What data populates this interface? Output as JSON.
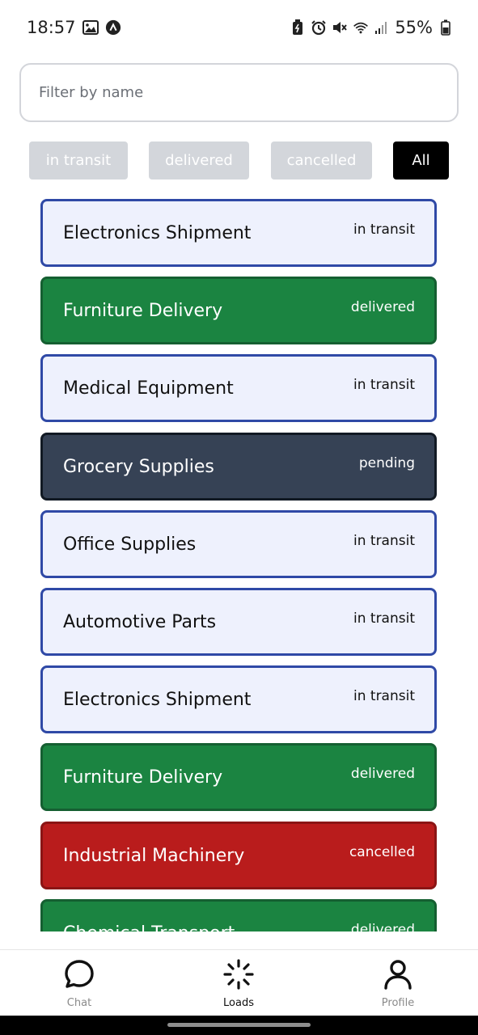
{
  "status_bar": {
    "time": "18:57",
    "battery_percent": "55%",
    "icons_left": [
      "image-icon",
      "app-notification-icon"
    ],
    "icons_right": [
      "battery-saver-icon",
      "alarm-icon",
      "mute-icon",
      "wifi-icon",
      "signal-icon",
      "battery-icon"
    ]
  },
  "search": {
    "placeholder": "Filter by name",
    "value": ""
  },
  "filters": [
    {
      "label": "in transit",
      "active": false
    },
    {
      "label": "delivered",
      "active": false
    },
    {
      "label": "cancelled",
      "active": false
    },
    {
      "label": "All",
      "active": true
    }
  ],
  "loads": [
    {
      "name": "Electronics Shipment",
      "status": "in transit"
    },
    {
      "name": "Furniture Delivery",
      "status": "delivered"
    },
    {
      "name": "Medical Equipment",
      "status": "in transit"
    },
    {
      "name": "Grocery Supplies",
      "status": "pending"
    },
    {
      "name": "Office Supplies",
      "status": "in transit"
    },
    {
      "name": "Automotive Parts",
      "status": "in transit"
    },
    {
      "name": "Electronics Shipment",
      "status": "in transit"
    },
    {
      "name": "Furniture Delivery",
      "status": "delivered"
    },
    {
      "name": "Industrial Machinery",
      "status": "cancelled"
    },
    {
      "name": "Chemical Transport",
      "status": "delivered"
    }
  ],
  "status_colors": {
    "in transit": "#eef1fd",
    "delivered": "#1b8441",
    "pending": "#364255",
    "cancelled": "#b91c1c"
  },
  "bottom_nav": [
    {
      "label": "Chat",
      "icon": "chat-bubble-icon",
      "active": false
    },
    {
      "label": "Loads",
      "icon": "loading-spinner-icon",
      "active": true
    },
    {
      "label": "Profile",
      "icon": "person-icon",
      "active": false
    }
  ]
}
